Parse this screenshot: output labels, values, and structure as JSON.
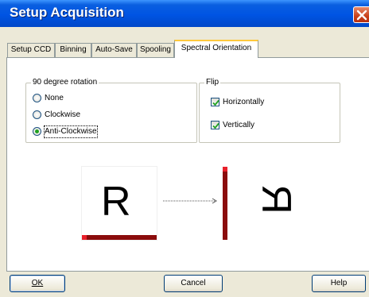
{
  "window": {
    "title": "Setup Acquisition"
  },
  "tabs": [
    {
      "label": "Setup CCD"
    },
    {
      "label": "Binning"
    },
    {
      "label": "Auto-Save"
    },
    {
      "label": "Spooling"
    },
    {
      "label": "Spectral Orientation",
      "active": true
    }
  ],
  "rotation_group": {
    "title": "90 degree rotation",
    "options": [
      {
        "label": "None",
        "selected": false
      },
      {
        "label": "Clockwise",
        "selected": false
      },
      {
        "label": "Anti-Clockwise",
        "selected": true
      }
    ]
  },
  "flip_group": {
    "title": "Flip",
    "options": [
      {
        "label": "Horizontally",
        "checked": true
      },
      {
        "label": "Vertically",
        "checked": true
      }
    ]
  },
  "preview": {
    "source_letter": "R",
    "result_letter": "R",
    "marker_color": "#e8202a",
    "bar_color": "#8b0c0c",
    "arrow_icon": "dotted-arrow-right"
  },
  "buttons": {
    "ok": "OK",
    "cancel": "Cancel",
    "help": "Help"
  }
}
